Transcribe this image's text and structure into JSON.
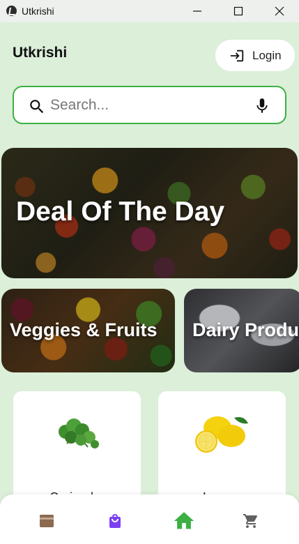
{
  "window": {
    "title": "Utkrishi"
  },
  "header": {
    "brand": "Utkrishi",
    "login_label": "Login"
  },
  "search": {
    "placeholder": "Search..."
  },
  "hero": {
    "title": "Deal Of The Day"
  },
  "categories": [
    {
      "label": "Veggies & Fruits"
    },
    {
      "label": "Dairy Products"
    }
  ],
  "products": [
    {
      "name": "Coriander",
      "icon": "coriander-image"
    },
    {
      "name": "Lemon",
      "icon": "lemon-image"
    }
  ],
  "bottom_nav": [
    {
      "icon": "wallet-icon",
      "color": "#8b6a50"
    },
    {
      "icon": "shopping-bag-icon",
      "color": "#7b3ff2"
    },
    {
      "icon": "home-icon",
      "color": "#3cb043",
      "active": true
    },
    {
      "icon": "cart-icon",
      "color": "#616161"
    }
  ],
  "colors": {
    "background": "#dbefd9",
    "accent": "#3cb043"
  }
}
